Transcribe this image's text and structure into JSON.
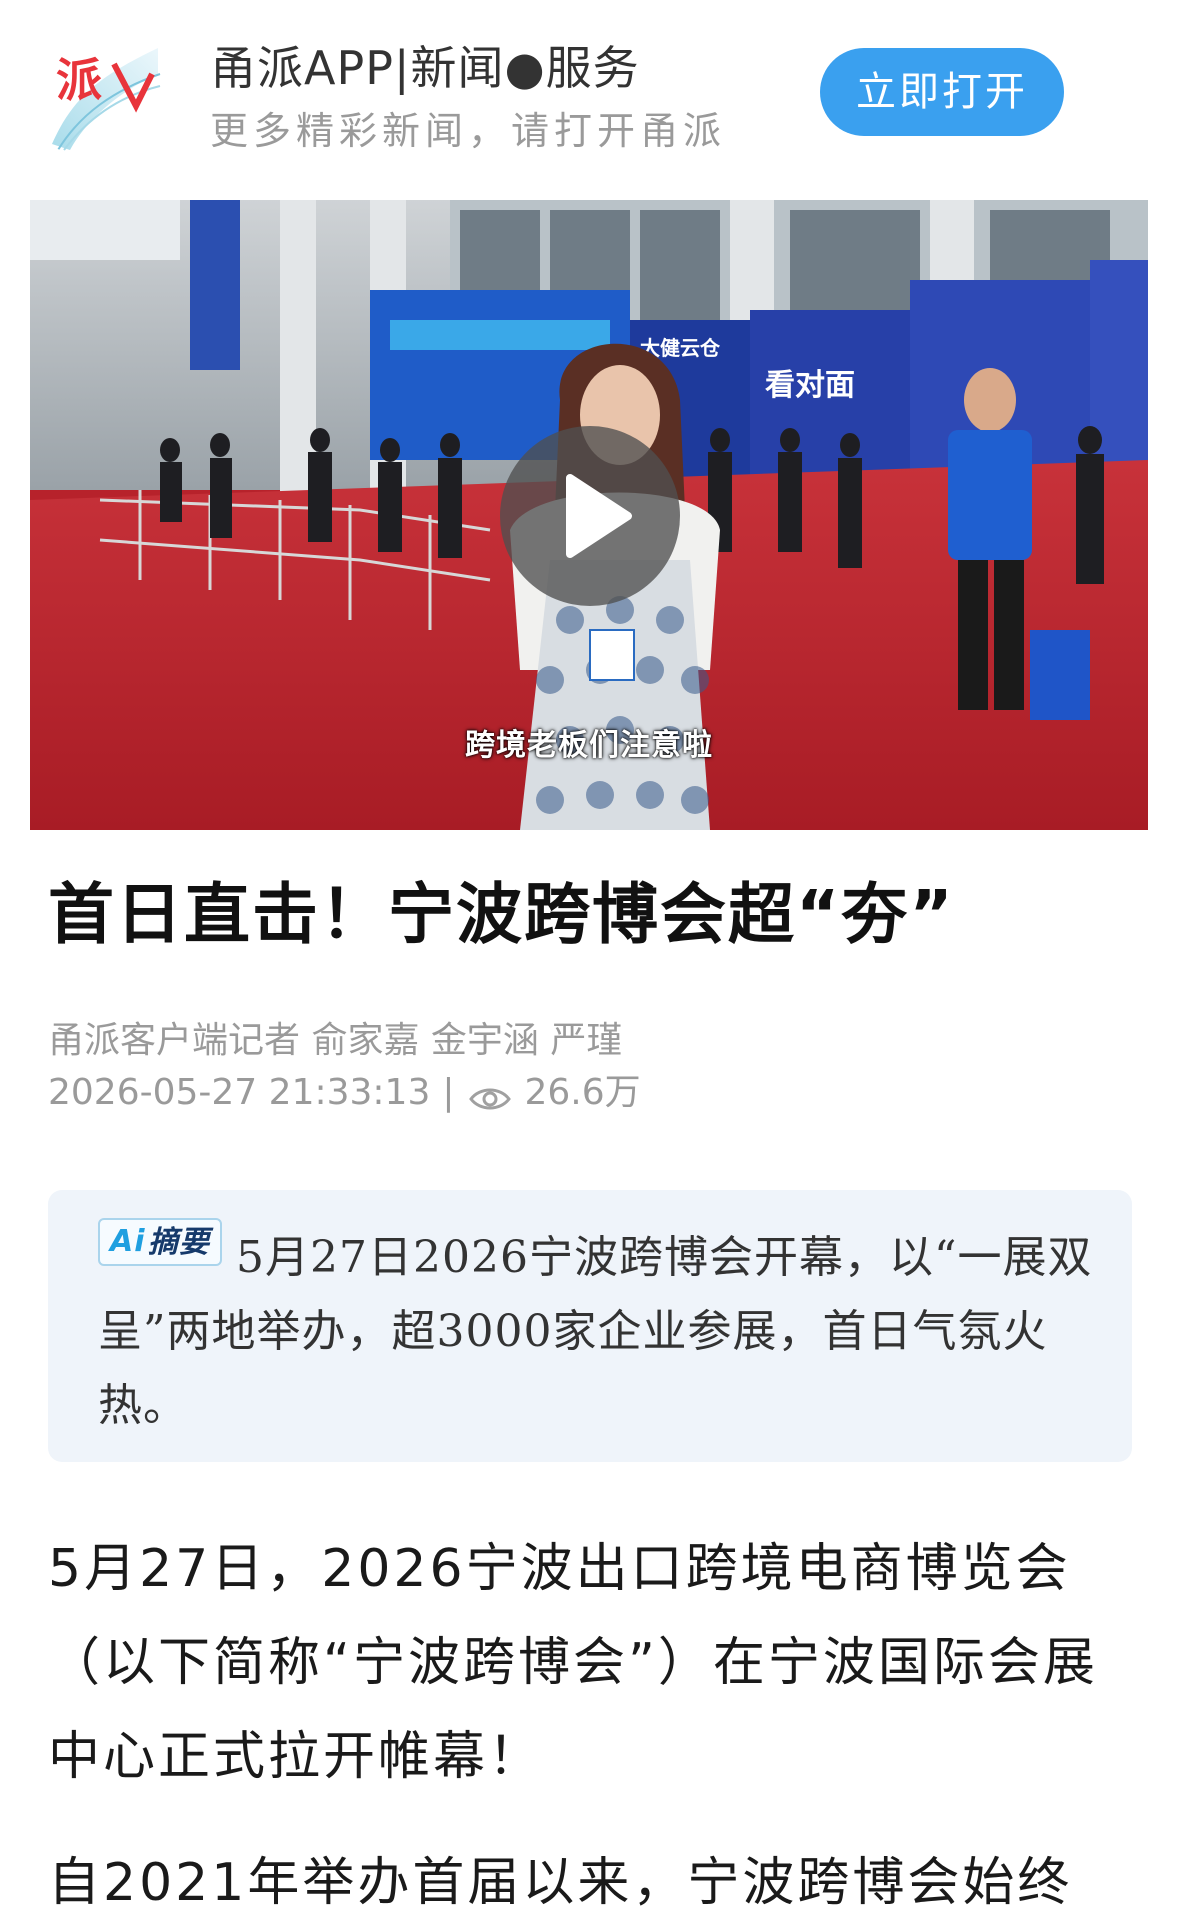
{
  "banner": {
    "logo_icon": "yongpai-logo-icon",
    "title": "甬派APP|新闻●服务",
    "subtitle": "更多精彩新闻，请打开甬派",
    "open_button": "立即打开"
  },
  "video": {
    "play_icon": "play-icon",
    "subtitle": "跨境老板们注意啦"
  },
  "article": {
    "headline": "首日直击！宁波跨博会超“夯”",
    "byline": "甬派客户端记者 俞家嘉 金宇涵 严瑾",
    "datetime": "2026-05-27 21:33:13",
    "separator": "|",
    "view_icon": "eye-icon",
    "views": "26.6万",
    "summary": {
      "tag_mark": "Ai",
      "tag_label": "摘要",
      "text": "5月27日2026宁波跨博会开幕，以“一展双呈”两地举办，超3000家企业参展，首日气氛火热。"
    },
    "paragraphs": [
      "5月27日，2026宁波出口跨境电商博览会（以下简称“宁波跨博会”）在宁波国际会展中心正式拉开帷幕！",
      "自2021年举办首届以来，宁波跨博会始终"
    ]
  },
  "colors": {
    "accent_blue": "#3aa0ef",
    "summary_bg": "#eff4fa",
    "carpet_red": "#b7222b"
  }
}
